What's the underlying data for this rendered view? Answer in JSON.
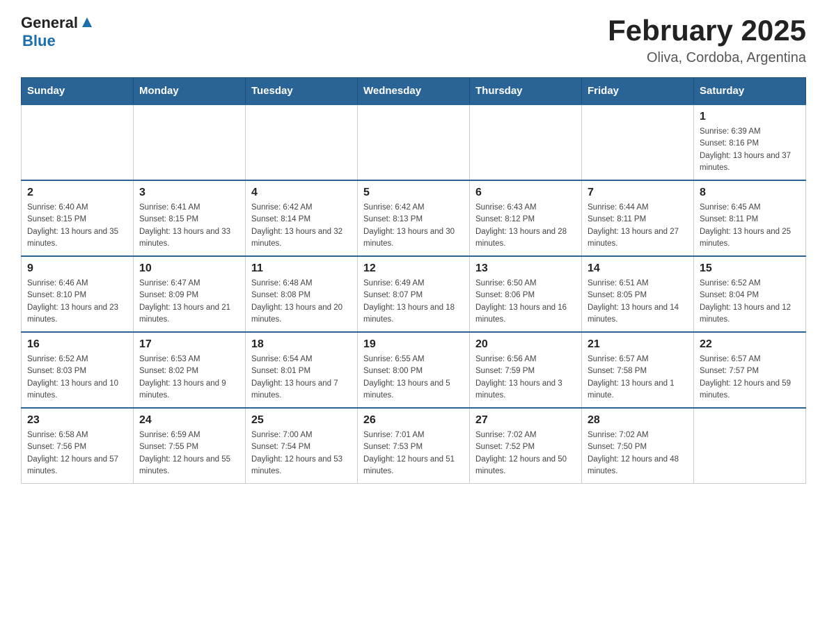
{
  "header": {
    "logo_general": "General",
    "logo_blue": "Blue",
    "title": "February 2025",
    "subtitle": "Oliva, Cordoba, Argentina"
  },
  "days_of_week": [
    "Sunday",
    "Monday",
    "Tuesday",
    "Wednesday",
    "Thursday",
    "Friday",
    "Saturday"
  ],
  "weeks": [
    [
      {
        "day": "",
        "info": ""
      },
      {
        "day": "",
        "info": ""
      },
      {
        "day": "",
        "info": ""
      },
      {
        "day": "",
        "info": ""
      },
      {
        "day": "",
        "info": ""
      },
      {
        "day": "",
        "info": ""
      },
      {
        "day": "1",
        "info": "Sunrise: 6:39 AM\nSunset: 8:16 PM\nDaylight: 13 hours and 37 minutes."
      }
    ],
    [
      {
        "day": "2",
        "info": "Sunrise: 6:40 AM\nSunset: 8:15 PM\nDaylight: 13 hours and 35 minutes."
      },
      {
        "day": "3",
        "info": "Sunrise: 6:41 AM\nSunset: 8:15 PM\nDaylight: 13 hours and 33 minutes."
      },
      {
        "day": "4",
        "info": "Sunrise: 6:42 AM\nSunset: 8:14 PM\nDaylight: 13 hours and 32 minutes."
      },
      {
        "day": "5",
        "info": "Sunrise: 6:42 AM\nSunset: 8:13 PM\nDaylight: 13 hours and 30 minutes."
      },
      {
        "day": "6",
        "info": "Sunrise: 6:43 AM\nSunset: 8:12 PM\nDaylight: 13 hours and 28 minutes."
      },
      {
        "day": "7",
        "info": "Sunrise: 6:44 AM\nSunset: 8:11 PM\nDaylight: 13 hours and 27 minutes."
      },
      {
        "day": "8",
        "info": "Sunrise: 6:45 AM\nSunset: 8:11 PM\nDaylight: 13 hours and 25 minutes."
      }
    ],
    [
      {
        "day": "9",
        "info": "Sunrise: 6:46 AM\nSunset: 8:10 PM\nDaylight: 13 hours and 23 minutes."
      },
      {
        "day": "10",
        "info": "Sunrise: 6:47 AM\nSunset: 8:09 PM\nDaylight: 13 hours and 21 minutes."
      },
      {
        "day": "11",
        "info": "Sunrise: 6:48 AM\nSunset: 8:08 PM\nDaylight: 13 hours and 20 minutes."
      },
      {
        "day": "12",
        "info": "Sunrise: 6:49 AM\nSunset: 8:07 PM\nDaylight: 13 hours and 18 minutes."
      },
      {
        "day": "13",
        "info": "Sunrise: 6:50 AM\nSunset: 8:06 PM\nDaylight: 13 hours and 16 minutes."
      },
      {
        "day": "14",
        "info": "Sunrise: 6:51 AM\nSunset: 8:05 PM\nDaylight: 13 hours and 14 minutes."
      },
      {
        "day": "15",
        "info": "Sunrise: 6:52 AM\nSunset: 8:04 PM\nDaylight: 13 hours and 12 minutes."
      }
    ],
    [
      {
        "day": "16",
        "info": "Sunrise: 6:52 AM\nSunset: 8:03 PM\nDaylight: 13 hours and 10 minutes."
      },
      {
        "day": "17",
        "info": "Sunrise: 6:53 AM\nSunset: 8:02 PM\nDaylight: 13 hours and 9 minutes."
      },
      {
        "day": "18",
        "info": "Sunrise: 6:54 AM\nSunset: 8:01 PM\nDaylight: 13 hours and 7 minutes."
      },
      {
        "day": "19",
        "info": "Sunrise: 6:55 AM\nSunset: 8:00 PM\nDaylight: 13 hours and 5 minutes."
      },
      {
        "day": "20",
        "info": "Sunrise: 6:56 AM\nSunset: 7:59 PM\nDaylight: 13 hours and 3 minutes."
      },
      {
        "day": "21",
        "info": "Sunrise: 6:57 AM\nSunset: 7:58 PM\nDaylight: 13 hours and 1 minute."
      },
      {
        "day": "22",
        "info": "Sunrise: 6:57 AM\nSunset: 7:57 PM\nDaylight: 12 hours and 59 minutes."
      }
    ],
    [
      {
        "day": "23",
        "info": "Sunrise: 6:58 AM\nSunset: 7:56 PM\nDaylight: 12 hours and 57 minutes."
      },
      {
        "day": "24",
        "info": "Sunrise: 6:59 AM\nSunset: 7:55 PM\nDaylight: 12 hours and 55 minutes."
      },
      {
        "day": "25",
        "info": "Sunrise: 7:00 AM\nSunset: 7:54 PM\nDaylight: 12 hours and 53 minutes."
      },
      {
        "day": "26",
        "info": "Sunrise: 7:01 AM\nSunset: 7:53 PM\nDaylight: 12 hours and 51 minutes."
      },
      {
        "day": "27",
        "info": "Sunrise: 7:02 AM\nSunset: 7:52 PM\nDaylight: 12 hours and 50 minutes."
      },
      {
        "day": "28",
        "info": "Sunrise: 7:02 AM\nSunset: 7:50 PM\nDaylight: 12 hours and 48 minutes."
      },
      {
        "day": "",
        "info": ""
      }
    ]
  ]
}
